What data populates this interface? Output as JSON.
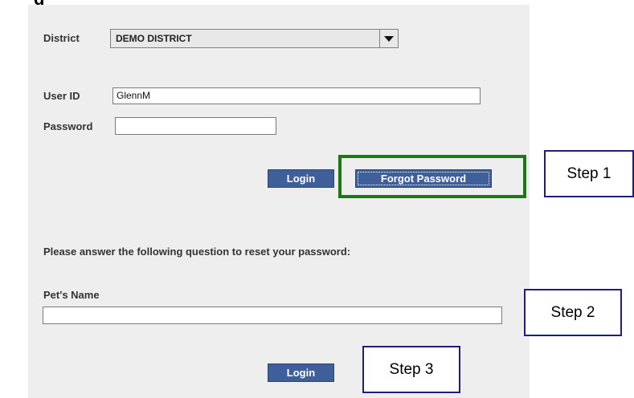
{
  "page_title_fragment": "g",
  "form": {
    "district_label": "District",
    "district_value": "DEMO DISTRICT",
    "userid_label": "User ID",
    "userid_value": "GlennM",
    "password_label": "Password",
    "password_value": "",
    "login_button": "Login",
    "forgot_password_button": "Forgot Password"
  },
  "reset": {
    "instruction": "Please answer the following question to reset your password:",
    "question_label": "Pet's Name",
    "answer_value": "",
    "login_button": "Login"
  },
  "annotations": {
    "step1": "Step 1",
    "step2": "Step 2",
    "step3": "Step 3",
    "highlight_color": "#1a7a10",
    "callout_border_color": "#1f1f7a"
  }
}
